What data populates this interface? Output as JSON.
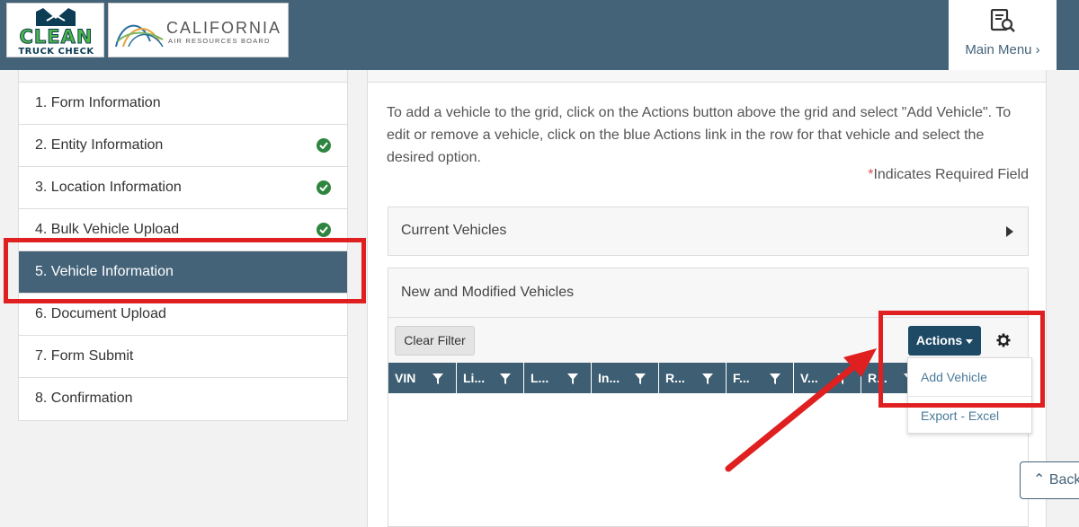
{
  "header": {
    "logo_clean": {
      "word": "CLEAN",
      "sub": "TRUCK CHECK"
    },
    "logo_carb": {
      "name": "CALIFORNIA",
      "sub": "AIR RESOURCES BOARD"
    },
    "main_menu": {
      "label": "Main Menu ›",
      "icon": "document-search-icon"
    }
  },
  "steps": [
    {
      "label": "1. Form Information",
      "complete": false,
      "active": false
    },
    {
      "label": "2. Entity Information",
      "complete": true,
      "active": false
    },
    {
      "label": "3. Location Information",
      "complete": true,
      "active": false
    },
    {
      "label": "4. Bulk Vehicle Upload",
      "complete": true,
      "active": false
    },
    {
      "label": "5. Vehicle Information",
      "complete": false,
      "active": true
    },
    {
      "label": "6. Document Upload",
      "complete": false,
      "active": false
    },
    {
      "label": "7. Form Submit",
      "complete": false,
      "active": false
    },
    {
      "label": "8. Confirmation",
      "complete": false,
      "active": false
    }
  ],
  "main": {
    "instructions": "To add a vehicle to the grid, click on the Actions button above the grid and select \"Add Vehicle\". To edit or remove a vehicle, click on the blue Actions link in the row for that vehicle and select the desired option.",
    "required_star": "*",
    "required_text": "Indicates Required Field",
    "current_vehicles_title": "Current Vehicles",
    "new_vehicles_title": "New and Modified Vehicles",
    "clear_filter_label": "Clear Filter",
    "actions_label": "Actions",
    "columns": [
      "VIN",
      "Li...",
      "L...",
      "In...",
      "R...",
      "F...",
      "V...",
      "R..."
    ],
    "dropdown": {
      "add_vehicle": "Add Vehicle",
      "export_excel": "Export - Excel"
    }
  },
  "back_label": "Back",
  "colors": {
    "header": "#446379",
    "active_step": "#446379",
    "grid_header": "#3d5e73",
    "actions_button": "#1e4a66",
    "annotation": "#e02020",
    "check": "#2e8540"
  }
}
